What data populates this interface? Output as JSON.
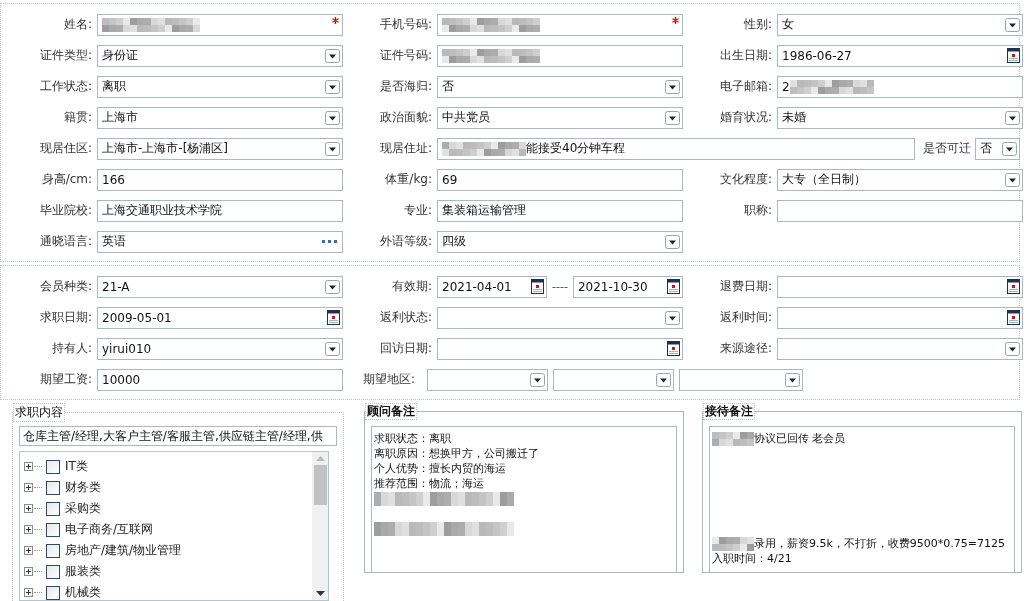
{
  "section_1": {
    "rows": [
      [
        {
          "label": "姓名:",
          "field": {
            "kind": "text",
            "required": true,
            "parts": [
              {
                "kind": "redacted"
              }
            ]
          }
        },
        {
          "label": "手机号码:",
          "field": {
            "kind": "text",
            "required": true,
            "parts": [
              {
                "kind": "redacted"
              }
            ]
          }
        },
        {
          "label": "性别:",
          "field": {
            "kind": "select",
            "value": "女"
          }
        }
      ],
      [
        {
          "label": "证件类型:",
          "field": {
            "kind": "select",
            "value": "身份证"
          }
        },
        {
          "label": "证件号码:",
          "field": {
            "kind": "text",
            "parts": [
              {
                "kind": "redacted"
              }
            ]
          }
        },
        {
          "label": "出生日期:",
          "field": {
            "kind": "date",
            "value": "1986-06-27"
          }
        }
      ],
      [
        {
          "label": "工作状态:",
          "field": {
            "kind": "select",
            "value": "离职"
          }
        },
        {
          "label": "是否海归:",
          "field": {
            "kind": "select",
            "value": "否"
          }
        },
        {
          "label": "电子邮箱:",
          "field": {
            "kind": "text",
            "parts": [
              {
                "kind": "text",
                "text": "2"
              },
              {
                "kind": "redacted"
              }
            ]
          }
        }
      ],
      [
        {
          "label": "籍贯:",
          "field": {
            "kind": "select",
            "value": "上海市"
          }
        },
        {
          "label": "政治面貌:",
          "field": {
            "kind": "select",
            "value": "中共党员"
          }
        },
        {
          "label": "婚育状况:",
          "field": {
            "kind": "select",
            "value": "未婚"
          }
        }
      ],
      [
        {
          "label": "现居住区:",
          "field": {
            "kind": "select",
            "value": "上海市-上海市-[杨浦区]"
          }
        },
        {
          "label": "现居住址:",
          "kind": "wide",
          "field": {
            "kind": "text",
            "parts": [
              {
                "kind": "redacted"
              },
              {
                "kind": "text",
                "text": "能接受40分钟车程"
              }
            ]
          },
          "extra": {
            "label": "是否可迁",
            "field": {
              "kind": "select",
              "value": "否"
            }
          }
        }
      ],
      [
        {
          "label": "身高/cm:",
          "field": {
            "kind": "text",
            "value": "166"
          }
        },
        {
          "label": "体重/kg:",
          "field": {
            "kind": "text",
            "value": "69"
          }
        },
        {
          "label": "文化程度:",
          "field": {
            "kind": "select",
            "value": "大专（全日制）"
          }
        }
      ],
      [
        {
          "label": "毕业院校:",
          "field": {
            "kind": "text",
            "value": "上海交通职业技术学院"
          }
        },
        {
          "label": "专业:",
          "field": {
            "kind": "text",
            "value": "集装箱运输管理"
          }
        },
        {
          "label": "职称:",
          "field": {
            "kind": "text"
          }
        }
      ],
      [
        {
          "label": "通晓语言:",
          "field": {
            "kind": "lookup",
            "value": "英语"
          }
        },
        {
          "label": "外语等级:",
          "field": {
            "kind": "select",
            "value": "四级"
          }
        }
      ]
    ]
  },
  "section_2": {
    "rows": [
      [
        {
          "label": "会员种类:",
          "field": {
            "kind": "select",
            "value": "21-A"
          }
        },
        {
          "label": "有效期:",
          "kind": "range",
          "from": {
            "kind": "date",
            "value": "2021-04-01"
          },
          "separator": "----",
          "to": {
            "kind": "date",
            "value": "2021-10-30"
          }
        },
        {
          "label": "退费日期:",
          "field": {
            "kind": "date"
          }
        }
      ],
      [
        {
          "label": "求职日期:",
          "field": {
            "kind": "date",
            "value": "2009-05-01"
          }
        },
        {
          "label": "返利状态:",
          "field": {
            "kind": "select"
          }
        },
        {
          "label": "返利时间:",
          "field": {
            "kind": "date"
          }
        }
      ],
      [
        {
          "label": "持有人:",
          "field": {
            "kind": "select",
            "value": "yirui010"
          }
        },
        {
          "label": "回访日期:",
          "field": {
            "kind": "date"
          }
        },
        {
          "label": "来源途径:",
          "field": {
            "kind": "select"
          }
        }
      ],
      [
        {
          "label": "期望工资:",
          "field": {
            "kind": "text",
            "value": "10000"
          }
        },
        {
          "label": "期望地区:",
          "kind": "multi",
          "fields": [
            {
              "kind": "select"
            },
            {
              "kind": "select"
            },
            {
              "kind": "select"
            }
          ]
        }
      ]
    ]
  },
  "panels": [
    {
      "kind": "picker",
      "title": "求职内容",
      "summary": "仓库主管/经理,大客户主管/客服主管,供应链主管/经理,供",
      "tree": [
        {
          "label": "IT类",
          "expanded": false,
          "checked": false
        },
        {
          "label": "财务类",
          "expanded": false,
          "checked": false
        },
        {
          "label": "采购类",
          "expanded": false,
          "checked": false
        },
        {
          "label": "电子商务/互联网",
          "expanded": false,
          "checked": false
        },
        {
          "label": "房地产/建筑/物业管理",
          "expanded": false,
          "checked": false
        },
        {
          "label": "服装类",
          "expanded": false,
          "checked": false
        },
        {
          "label": "机械类",
          "expanded": false,
          "checked": false
        }
      ]
    },
    {
      "kind": "note",
      "title": "顾问备注",
      "lines": [
        {
          "kind": "text",
          "parts": [
            {
              "kind": "text",
              "text": "求职状态：离职"
            }
          ]
        },
        {
          "kind": "text",
          "parts": [
            {
              "kind": "text",
              "text": "离职原因：想换甲方，公司搬迁了"
            }
          ]
        },
        {
          "kind": "text",
          "parts": [
            {
              "kind": "text",
              "text": "个人优势：擅长内贸的海运"
            }
          ]
        },
        {
          "kind": "text",
          "parts": [
            {
              "kind": "text",
              "text": "推荐范围：物流；海运"
            }
          ]
        },
        {
          "kind": "text",
          "parts": [
            {
              "kind": "redacted"
            }
          ]
        },
        {
          "kind": "blank"
        },
        {
          "kind": "text",
          "parts": [
            {
              "kind": "redacted"
            }
          ]
        }
      ]
    },
    {
      "kind": "note",
      "title": "接待备注",
      "lines": [
        {
          "kind": "text",
          "parts": [
            {
              "kind": "redacted"
            },
            {
              "kind": "text",
              "text": "协议已回传 老会员"
            }
          ]
        },
        {
          "kind": "blank"
        },
        {
          "kind": "blank"
        },
        {
          "kind": "blank"
        },
        {
          "kind": "blank"
        },
        {
          "kind": "blank"
        },
        {
          "kind": "blank"
        },
        {
          "kind": "text",
          "parts": [
            {
              "kind": "redacted"
            },
            {
              "kind": "text",
              "text": "录用，薪资9.5k，不打折，收费9500*0.75=7125"
            }
          ]
        },
        {
          "kind": "text",
          "parts": [
            {
              "kind": "text",
              "text": "入职时间：4/21"
            }
          ]
        }
      ]
    }
  ]
}
